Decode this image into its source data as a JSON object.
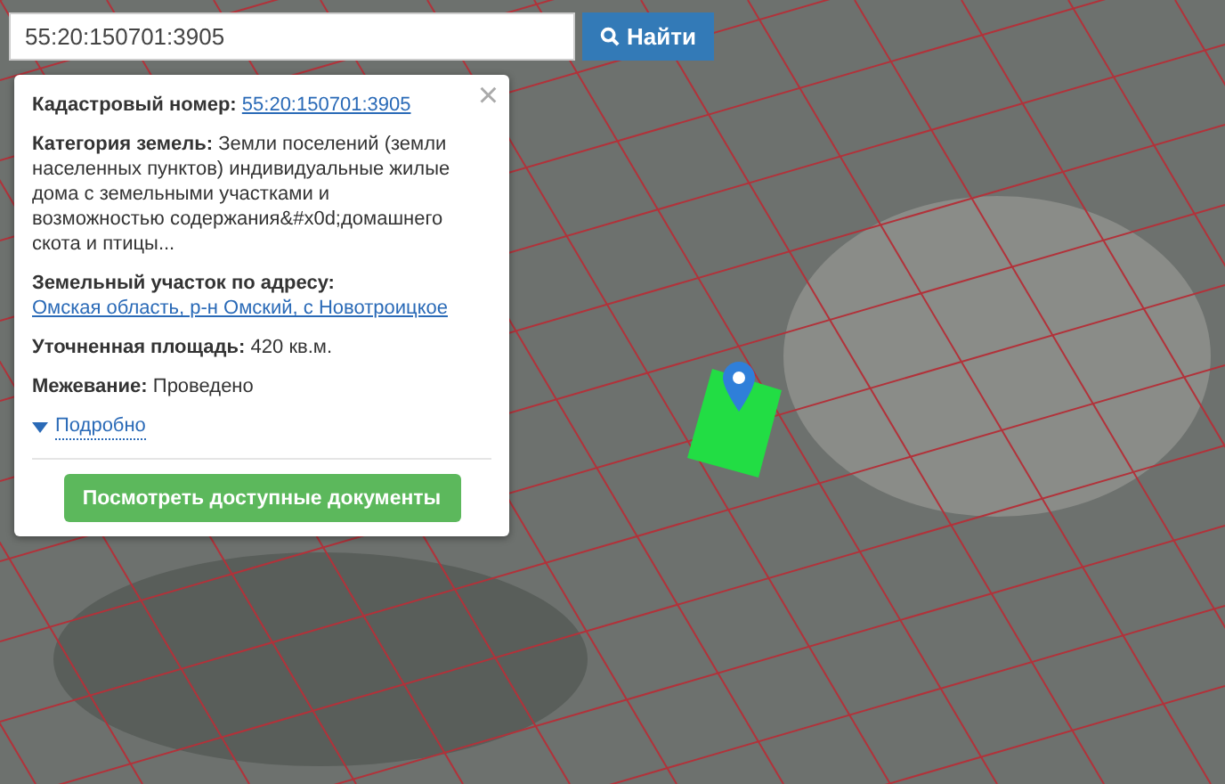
{
  "search": {
    "value": "55:20:150701:3905",
    "button": "Найти"
  },
  "popup": {
    "close": "×",
    "fields": [
      {
        "label": "Кадастровый номер:",
        "value": "55:20:150701:3905",
        "kind": "link"
      },
      {
        "label": "Категория земель:",
        "value": "Земли поселений (земли населенных пунктов) индивидуальные жилые дома с земельными участками и возможностью содержания&#x0d;домашнего скота и птицы...",
        "kind": "text"
      },
      {
        "label": "Земельный участок по адресу:",
        "value": "Омская область, р-н Омский, с Новотроицкое",
        "kind": "link"
      },
      {
        "label": "Уточненная площадь:",
        "value": "420 кв.м.",
        "kind": "text"
      },
      {
        "label": "Межевание:",
        "value": "Проведено",
        "kind": "text"
      }
    ],
    "details": {
      "label": "Подробно",
      "expanded": false
    },
    "action": "Посмотреть доступные документы"
  }
}
